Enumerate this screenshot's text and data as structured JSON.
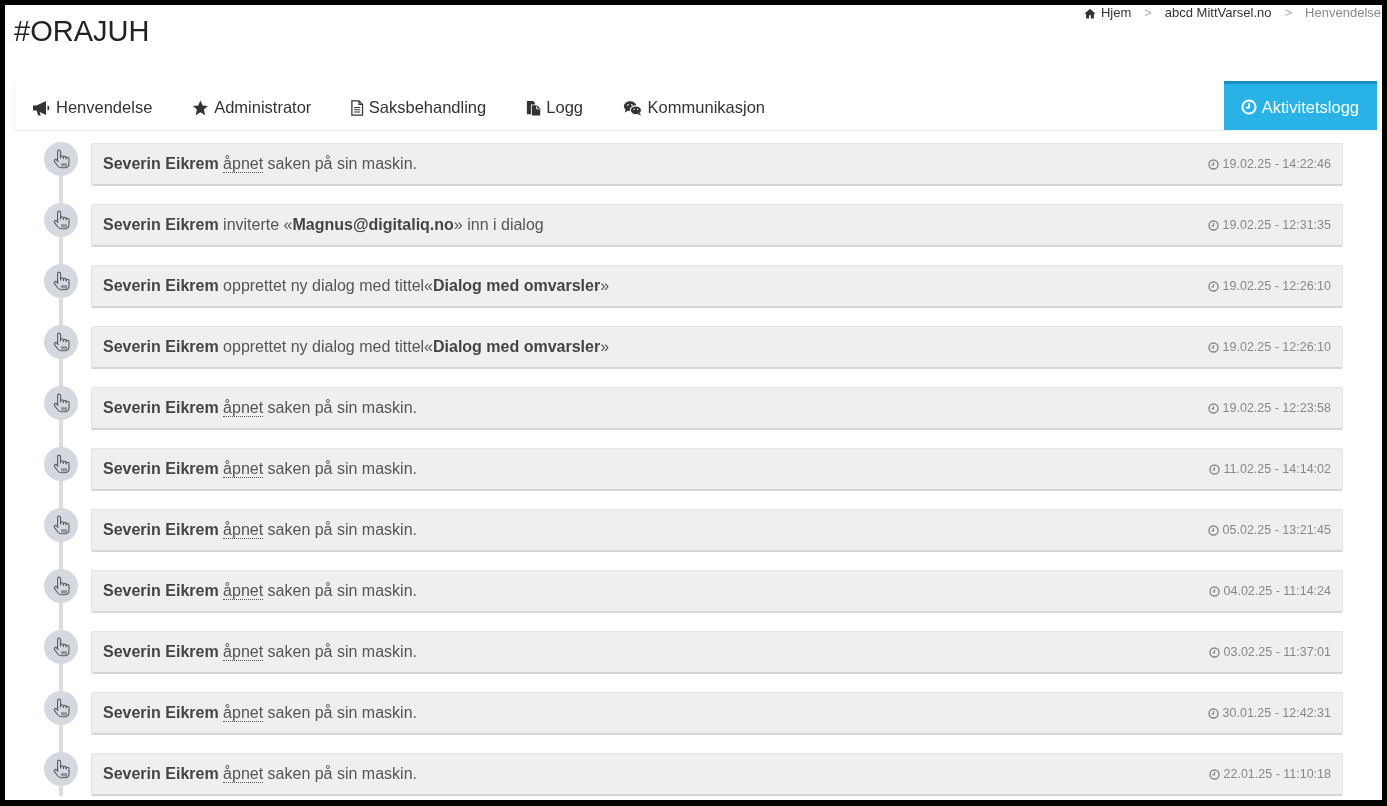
{
  "page_title": "#ORAJUH",
  "breadcrumb": {
    "items": [
      {
        "label": "Hjem",
        "active": false
      },
      {
        "separator": ">",
        "label": "abcd MittVarsel.no",
        "active": false
      },
      {
        "separator": ">",
        "label": "Henvendelse",
        "active": true
      }
    ]
  },
  "tabs": [
    {
      "label": "Henvendelse",
      "selected": false
    },
    {
      "label": "Administrator",
      "selected": false
    },
    {
      "label": "Saksbehandling",
      "selected": false
    },
    {
      "label": "Logg",
      "selected": false
    },
    {
      "label": "Kommunikasjon",
      "selected": false
    },
    {
      "label": "Aktivitetslogg",
      "selected": true
    }
  ],
  "activity_log": [
    {
      "actor": "Severin Eikrem",
      "verb": "åpnet",
      "dotted_underline": true,
      "detail": "saken på sin maskin.",
      "time": "19.02.25 - 14:22:46"
    },
    {
      "actor": "Severin Eikrem",
      "verb": "inviterte",
      "dotted_underline": false,
      "detail": "«**Magnus@digitaliq.no**» inn i dialog",
      "time": "19.02.25 - 12:31:35"
    },
    {
      "actor": "Severin Eikrem",
      "verb": "opprettet",
      "dotted_underline": false,
      "detail": "ny dialog med tittel«**Dialog med omvarsler**»",
      "time": "19.02.25 - 12:26:10"
    },
    {
      "actor": "Severin Eikrem",
      "verb": "opprettet",
      "dotted_underline": false,
      "detail": "ny dialog med tittel«**Dialog med omvarsler**»",
      "time": "19.02.25 - 12:26:10"
    },
    {
      "actor": "Severin Eikrem",
      "verb": "åpnet",
      "dotted_underline": true,
      "detail": "saken på sin maskin.",
      "time": "19.02.25 - 12:23:58"
    },
    {
      "actor": "Severin Eikrem",
      "verb": "åpnet",
      "dotted_underline": true,
      "detail": "saken på sin maskin.",
      "time": "11.02.25 - 14:14:02"
    },
    {
      "actor": "Severin Eikrem",
      "verb": "åpnet",
      "dotted_underline": true,
      "detail": "saken på sin maskin.",
      "time": "05.02.25 - 13:21:45"
    },
    {
      "actor": "Severin Eikrem",
      "verb": "åpnet",
      "dotted_underline": true,
      "detail": "saken på sin maskin.",
      "time": "04.02.25 - 11:14:24"
    },
    {
      "actor": "Severin Eikrem",
      "verb": "åpnet",
      "dotted_underline": true,
      "detail": "saken på sin maskin.",
      "time": "03.02.25 - 11:37:01"
    },
    {
      "actor": "Severin Eikrem",
      "verb": "åpnet",
      "dotted_underline": true,
      "detail": "saken på sin maskin.",
      "time": "30.01.25 - 12:42:31"
    },
    {
      "actor": "Severin Eikrem",
      "verb": "åpnet",
      "dotted_underline": true,
      "detail": "saken på sin maskin.",
      "time": "22.01.25 - 11:10:18"
    }
  ]
}
